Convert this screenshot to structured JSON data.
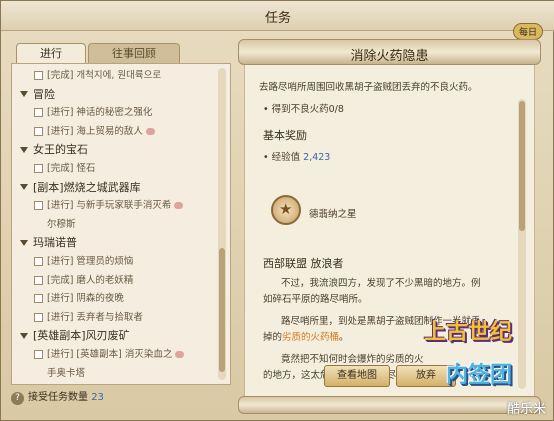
{
  "window": {
    "title": "任务",
    "daily_badge": "每日"
  },
  "tabs": [
    {
      "label": "进行"
    },
    {
      "label": "往事回顾"
    }
  ],
  "tree": [
    {
      "type": "sub",
      "label": "[完成] 개척지에, 원대륙으로"
    },
    {
      "type": "cat",
      "label": "冒险"
    },
    {
      "type": "sub",
      "label": "[进行] 神话的秘密之强化"
    },
    {
      "type": "sub",
      "label": "[进行] 海上贸易的敌人",
      "bubble": true
    },
    {
      "type": "cat",
      "label": "女王的宝石"
    },
    {
      "type": "sub",
      "label": "[完成] 怪石"
    },
    {
      "type": "cat",
      "label": "[副本]燃烧之城武器库"
    },
    {
      "type": "sub",
      "label": "[进行] 与新手玩家联手消灭希",
      "bubble": true
    },
    {
      "type": "cont",
      "label": "尔穆斯"
    },
    {
      "type": "cat",
      "label": "玛瑞诺普"
    },
    {
      "type": "sub",
      "label": "[进行] 管理员的烦恼"
    },
    {
      "type": "sub",
      "label": "[完成] 磨人的老妖精"
    },
    {
      "type": "sub",
      "label": "[进行] 阴森的夜晚"
    },
    {
      "type": "sub",
      "label": "[进行] 丢弃者与拾取者"
    },
    {
      "type": "cat",
      "label": "[英雄副本]风刃废矿"
    },
    {
      "type": "sub",
      "label": "[进行] [英雄副本] 消灭染血之",
      "bubble": true
    },
    {
      "type": "cont",
      "label": "手奥卡塔"
    }
  ],
  "footer": {
    "label": "接受任务数量",
    "count": "23"
  },
  "quest": {
    "title": "消除火药隐患",
    "desc": "去路尽哨所周围回收黑胡子盗贼团丢弃的不良火药。",
    "objective": "• 得到不良火药0/8",
    "reward_heading": "基本奖励",
    "exp_label": "• 经验值",
    "exp_value": "2,423",
    "item_name": "德翡纳之星",
    "npc": "西部联盟 放浪者",
    "dialog1a": "不过，我流浪四方，发现了不少黑暗的地方。例",
    "dialog1b": "如碎石平原的路尽哨所。",
    "dialog2a": "路尽哨所里，到处是黑胡子盗贼团制作一半就丢",
    "dialog2b_pre": "掉的",
    "dialog2b_hl": "劣质的火药桶",
    "dialog2b_post": "。",
    "dialog3a": "竟然把不知何时会爆炸的劣质的火",
    "dialog3b": "的地方，这太危险了！但是路尽",
    "btn_map": "查看地图",
    "btn_abandon": "放弃"
  },
  "watermark": {
    "line1": "上古世纪",
    "line2": "内签团",
    "line3": "酷乐米"
  }
}
